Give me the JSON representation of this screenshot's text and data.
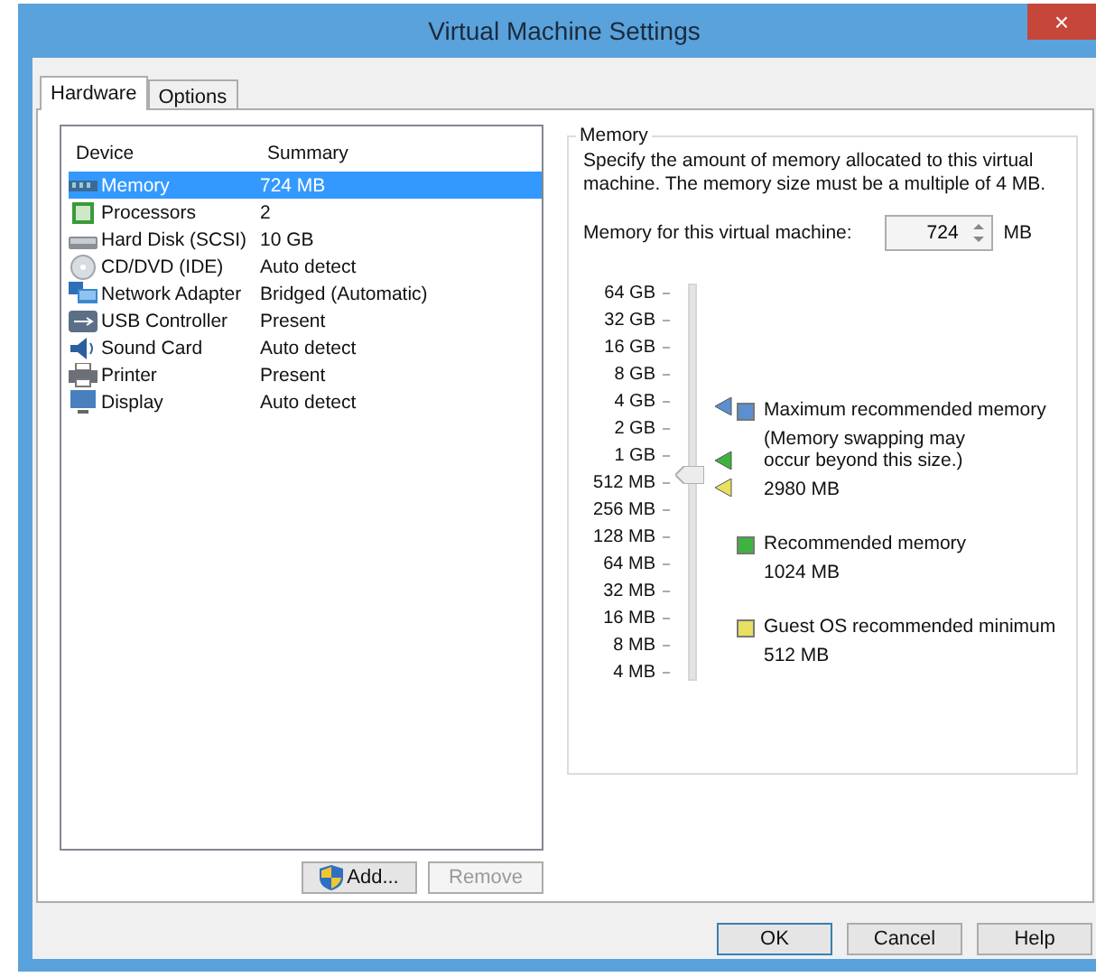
{
  "window": {
    "title": "Virtual Machine Settings",
    "close": "×"
  },
  "tabs": [
    {
      "label": "Hardware",
      "selected": true
    },
    {
      "label": "Options",
      "selected": false
    }
  ],
  "devices": {
    "columns": [
      "Device",
      "Summary"
    ],
    "rows": [
      {
        "kind": "memory",
        "device": "Memory",
        "summary": "724 MB",
        "selected": true
      },
      {
        "kind": "processor",
        "device": "Processors",
        "summary": "2",
        "selected": false
      },
      {
        "kind": "disk",
        "device": "Hard Disk (SCSI)",
        "summary": "10 GB",
        "selected": false
      },
      {
        "kind": "cd",
        "device": "CD/DVD (IDE)",
        "summary": "Auto detect",
        "selected": false
      },
      {
        "kind": "network",
        "device": "Network Adapter",
        "summary": "Bridged (Automatic)",
        "selected": false
      },
      {
        "kind": "usb",
        "device": "USB Controller",
        "summary": "Present",
        "selected": false
      },
      {
        "kind": "sound",
        "device": "Sound Card",
        "summary": "Auto detect",
        "selected": false
      },
      {
        "kind": "printer",
        "device": "Printer",
        "summary": "Present",
        "selected": false
      },
      {
        "kind": "display",
        "device": "Display",
        "summary": "Auto detect",
        "selected": false
      }
    ]
  },
  "device_buttons": [
    {
      "label": "Add...",
      "disabled": false,
      "shield": true
    },
    {
      "label": "Remove",
      "disabled": true,
      "shield": false
    }
  ],
  "memory": {
    "title": "Memory",
    "description": "Specify the amount of memory allocated to this virtual machine. The memory size must be a multiple of 4 MB.",
    "field_label": "Memory for this virtual machine:",
    "value": "724",
    "unit": "MB",
    "scale": [
      "64 GB",
      "32 GB",
      "16 GB",
      "8 GB",
      "4 GB",
      "2 GB",
      "1 GB",
      "512 MB",
      "256 MB",
      "128 MB",
      "64 MB",
      "32 MB",
      "16 MB",
      "8 MB",
      "4 MB"
    ],
    "slider": {
      "level": 0.536
    },
    "markers": [
      {
        "color": "#5b8fd0"
      },
      {
        "color": "#3fb23f"
      },
      {
        "color": "#e8e060"
      }
    ],
    "legend": [
      {
        "color": "#5b8fd0",
        "label": "Maximum recommended memory",
        "note": "(Memory swapping may occur beyond this size.)",
        "value": "2980 MB"
      },
      {
        "color": "#3fb23f",
        "label": "Recommended memory",
        "value": "1024 MB"
      },
      {
        "color": "#e8e060",
        "label": "Guest OS recommended minimum",
        "value": "512 MB"
      }
    ]
  },
  "buttons": [
    {
      "label": "OK",
      "default": true
    },
    {
      "label": "Cancel",
      "default": false
    },
    {
      "label": "Help",
      "default": false
    }
  ]
}
